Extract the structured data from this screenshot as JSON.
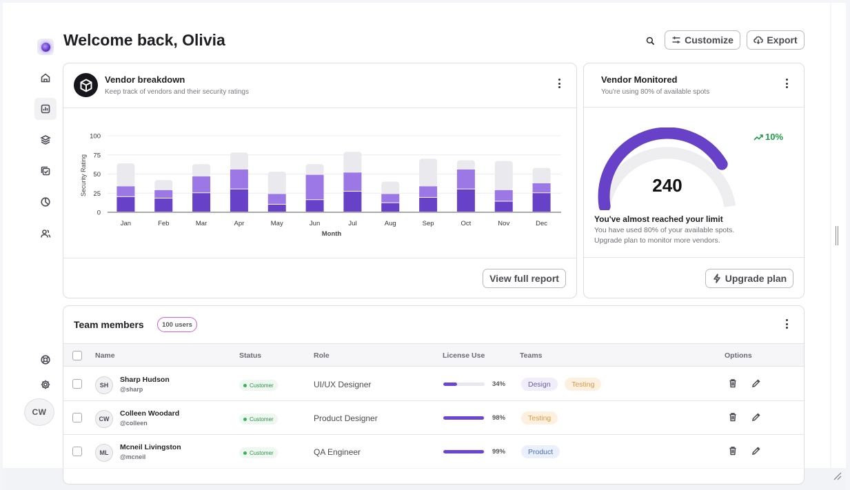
{
  "header": {
    "title": "Welcome back, Olivia",
    "customize_label": "Customize",
    "export_label": "Export",
    "icons": [
      "search-icon",
      "sliders-icon",
      "cloud-download-icon"
    ]
  },
  "sidebar": {
    "items": [
      {
        "name": "home",
        "icon": "home-icon"
      },
      {
        "name": "dashboard",
        "icon": "bar-chart-icon",
        "active": true
      },
      {
        "name": "layers",
        "icon": "layers-icon"
      },
      {
        "name": "tasks",
        "icon": "check-square-icon"
      },
      {
        "name": "reports",
        "icon": "pie-chart-icon"
      },
      {
        "name": "users",
        "icon": "users-icon"
      }
    ],
    "bottom": [
      {
        "name": "support",
        "icon": "lifebuoy-icon"
      },
      {
        "name": "settings",
        "icon": "gear-icon"
      }
    ],
    "user_initials": "CW"
  },
  "vendor_breakdown": {
    "title": "Vendor breakdown",
    "subtitle": "Keep track of vendors and their security ratings",
    "view_report_label": "View full report"
  },
  "chart_data": {
    "type": "bar",
    "stacked": true,
    "categories": [
      "Jan",
      "Feb",
      "Mar",
      "Apr",
      "May",
      "Jun",
      "Jul",
      "Aug",
      "Sep",
      "Oct",
      "Nov",
      "Dec"
    ],
    "series": [
      {
        "values": [
          20,
          18,
          25,
          30,
          10,
          16,
          27,
          12,
          19,
          30,
          14,
          25
        ],
        "color": "#6741c7"
      },
      {
        "values": [
          14,
          11,
          22,
          26,
          14,
          33,
          25,
          12,
          15,
          26,
          15,
          13
        ],
        "color": "#9b78e6"
      },
      {
        "values": [
          30,
          13,
          16,
          22,
          29,
          14,
          27,
          16,
          36,
          12,
          38,
          20
        ],
        "color": "#e9e9ee"
      }
    ],
    "xlabel": "Month",
    "ylabel": "Security Rating",
    "yticks": [
      0,
      25,
      50,
      75,
      100
    ],
    "ylim": [
      0,
      100
    ],
    "grid": true
  },
  "vendor_monitored": {
    "title": "Vendor Monitored",
    "subtitle": "You're using 80% of available spots",
    "value": "240",
    "gauge_fraction": 0.8,
    "trend": "10%",
    "limit_title": "You've almost reached your limit",
    "limit_line1": "You have used 80% of your available spots.",
    "limit_line2": "Upgrade plan to monitor more vendors.",
    "upgrade_label": "Upgrade plan"
  },
  "team": {
    "title": "Team members",
    "badge": "100 users",
    "columns": [
      "Name",
      "Status",
      "Role",
      "License Use",
      "Teams",
      "Options"
    ],
    "rows": [
      {
        "initials": "SH",
        "name": "Sharp Hudson",
        "handle": "@sharp",
        "status": "Customer",
        "role": "UI/UX Designer",
        "license": 0.34,
        "license_label": "34%",
        "teams": [
          {
            "label": "Design",
            "kind": "design"
          },
          {
            "label": "Testing",
            "kind": "testing"
          }
        ]
      },
      {
        "initials": "CW",
        "name": "Colleen Woodard",
        "handle": "@colleen",
        "status": "Customer",
        "role": "Product Designer",
        "license": 0.98,
        "license_label": "98%",
        "teams": [
          {
            "label": "Testing",
            "kind": "testing"
          }
        ]
      },
      {
        "initials": "ML",
        "name": "Mcneil Livingston",
        "handle": "@mcneil",
        "status": "Customer",
        "role": "QA Engineer",
        "license": 0.99,
        "license_label": "99%",
        "teams": [
          {
            "label": "Product",
            "kind": "product"
          }
        ]
      }
    ]
  }
}
